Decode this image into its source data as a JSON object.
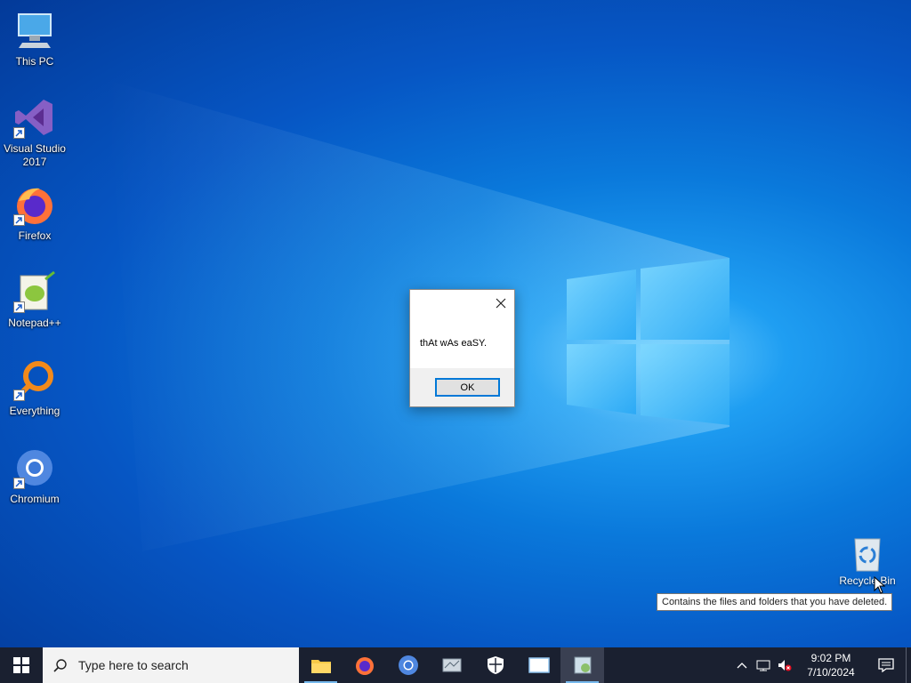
{
  "desktop": {
    "icons": [
      {
        "label": "This PC",
        "icon": "monitor-icon"
      },
      {
        "label": "Visual Studio 2017",
        "icon": "visual-studio-icon"
      },
      {
        "label": "Firefox",
        "icon": "firefox-icon"
      },
      {
        "label": "Notepad++",
        "icon": "notepadpp-icon"
      },
      {
        "label": "Everything",
        "icon": "magnifier-icon"
      },
      {
        "label": "Chromium",
        "icon": "chromium-icon"
      }
    ],
    "recycle_bin": {
      "label": "Recycle Bin",
      "icon": "recycle-bin-icon"
    },
    "tooltip": "Contains the files and folders that you have deleted."
  },
  "dialog": {
    "message": "thAt wAs eaSY.",
    "ok_label": "OK",
    "close_icon": "close-icon"
  },
  "taskbar": {
    "search_placeholder": "Type here to search",
    "apps": [
      {
        "name": "file-explorer",
        "icon": "folder-icon"
      },
      {
        "name": "firefox",
        "icon": "firefox-icon"
      },
      {
        "name": "chromium",
        "icon": "chromium-icon"
      },
      {
        "name": "app-4",
        "icon": "app-icon"
      },
      {
        "name": "windows-security",
        "icon": "shield-icon"
      },
      {
        "name": "app-6",
        "icon": "window-icon"
      },
      {
        "name": "app-7",
        "icon": "app-icon"
      }
    ],
    "clock": {
      "time": "9:02 PM",
      "date": "7/10/2024"
    }
  },
  "colors": {
    "accent": "#0078d7",
    "taskbar": "#1a2030"
  }
}
